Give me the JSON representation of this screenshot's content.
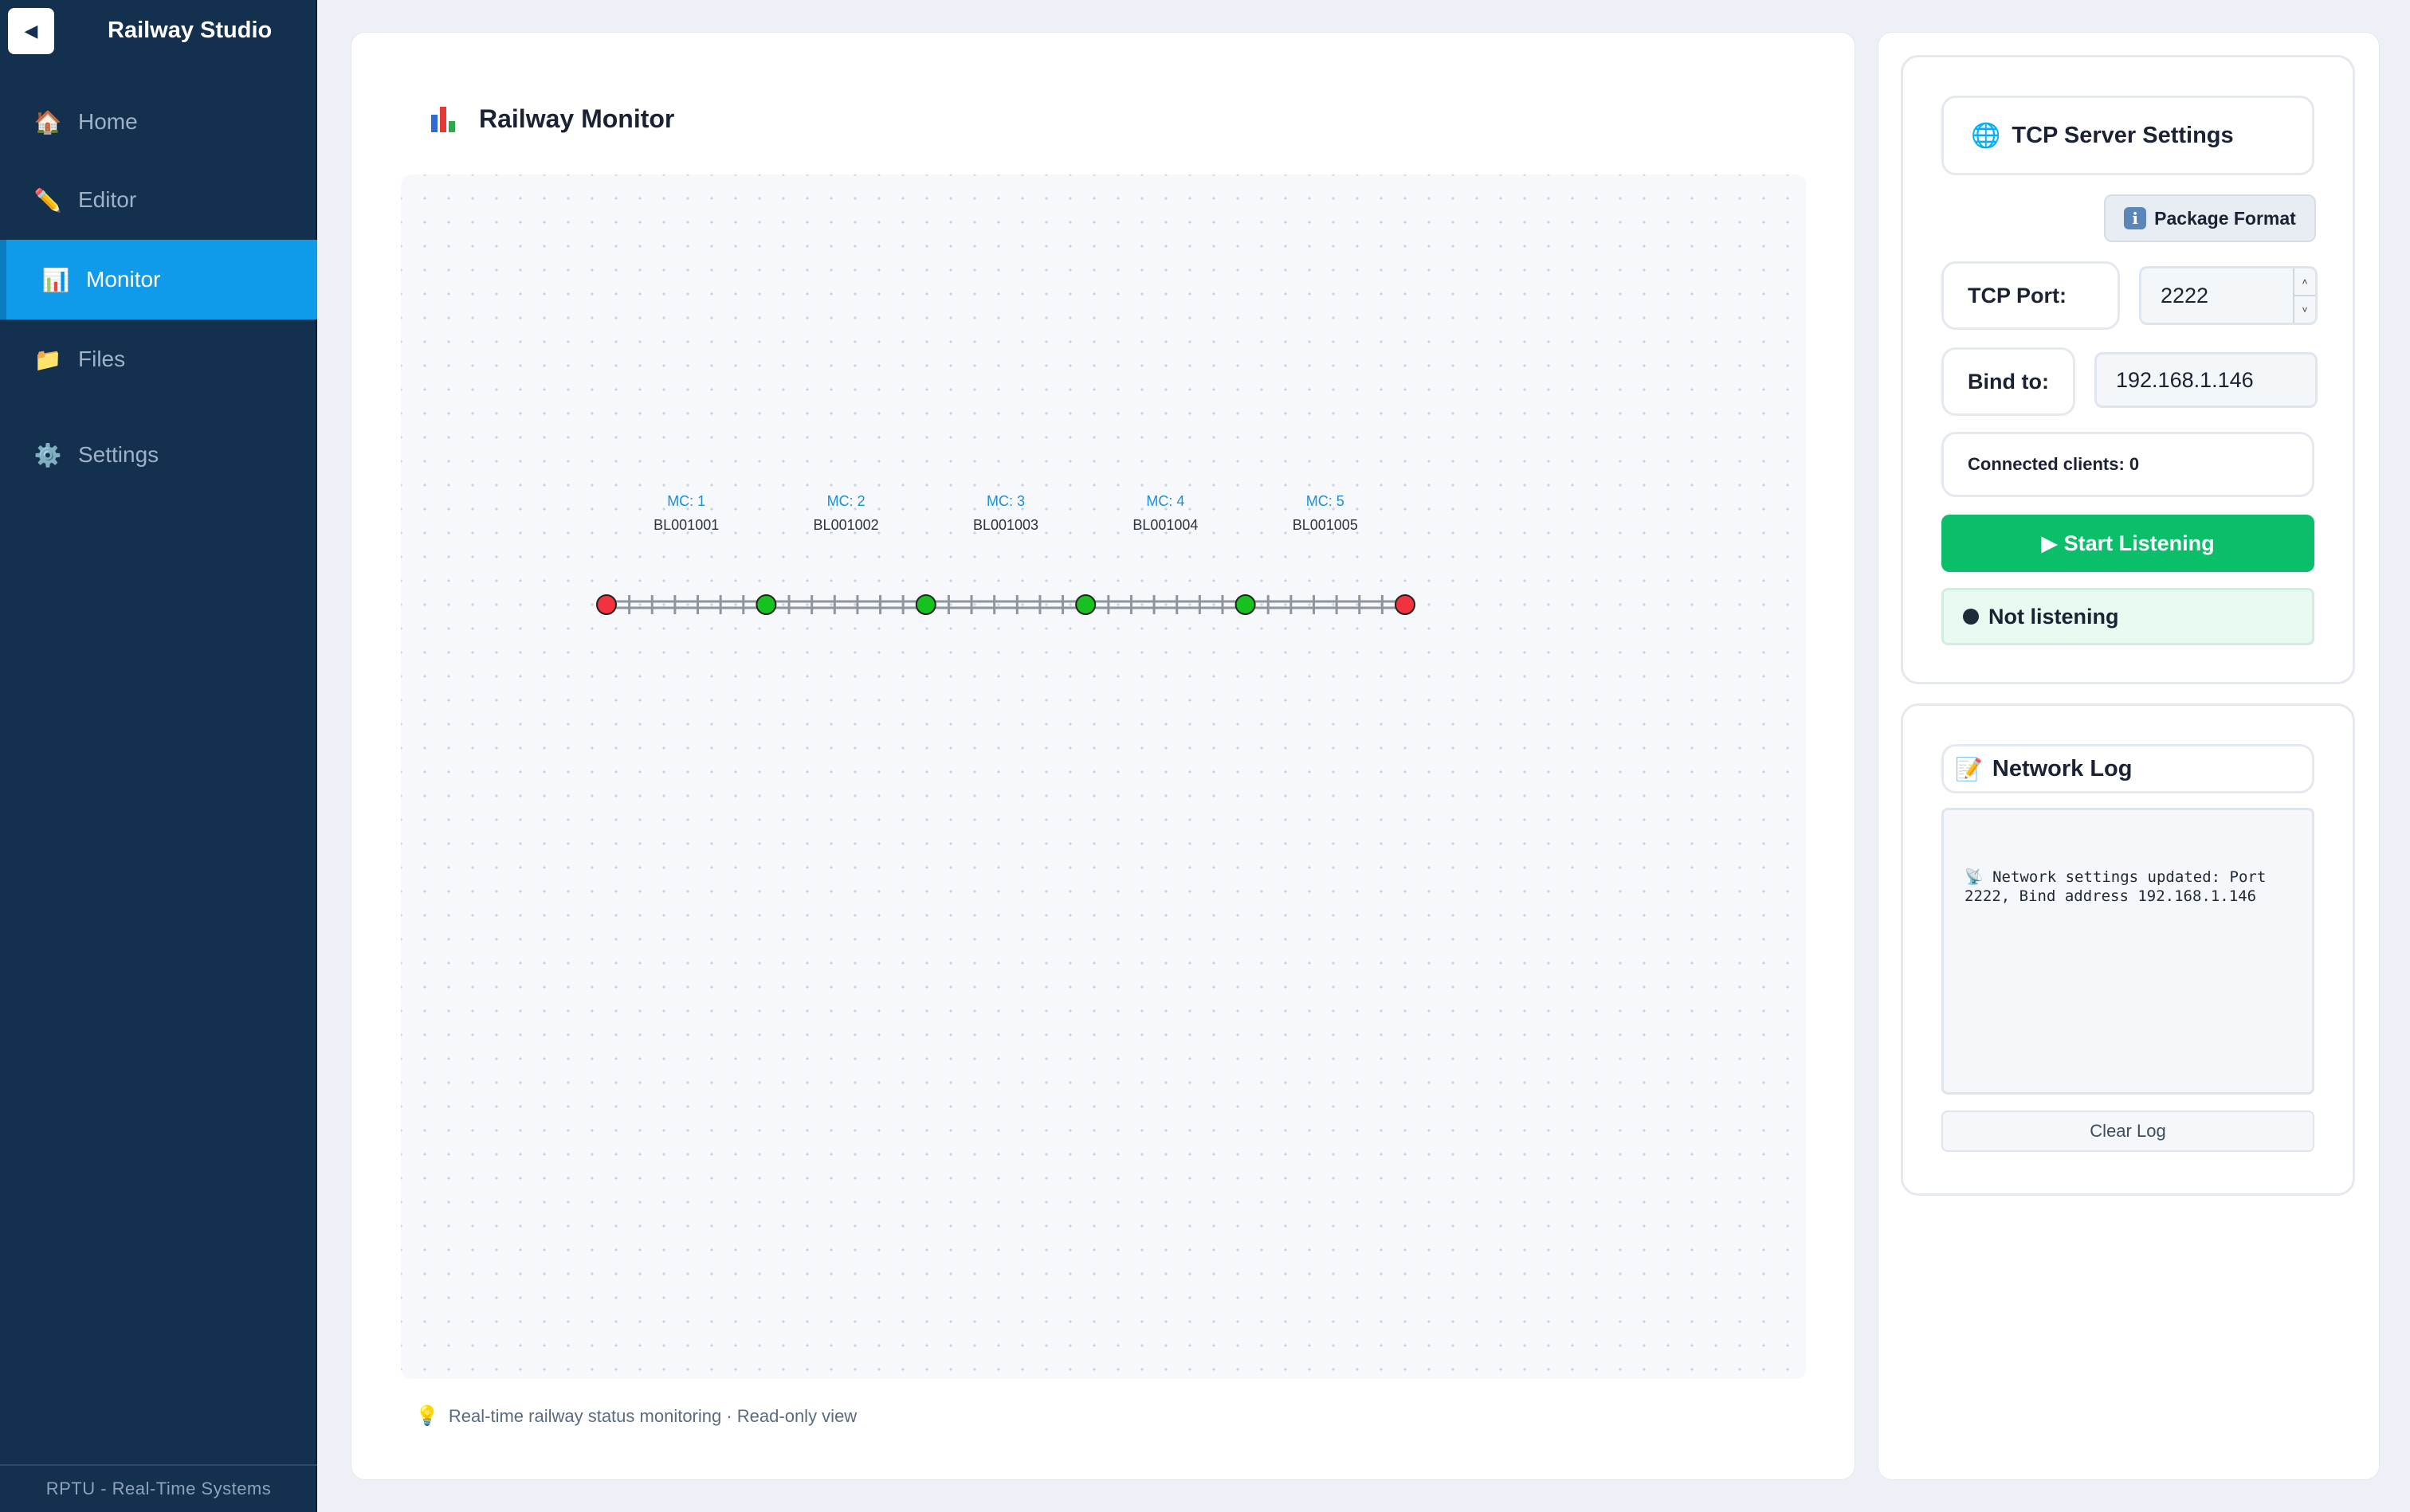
{
  "sidebar": {
    "collapse_icon": "◀",
    "app_title": "Railway Studio",
    "items": [
      {
        "label": "Home",
        "icon": "🏠"
      },
      {
        "label": "Editor",
        "icon": "✏️"
      },
      {
        "label": "Monitor",
        "icon": "📊"
      },
      {
        "label": "Files",
        "icon": "📁"
      },
      {
        "label": "Settings",
        "icon": "⚙️"
      }
    ],
    "active_item": "Monitor",
    "footer": "RPTU - Real-Time Systems"
  },
  "main": {
    "title": "Railway Monitor",
    "hint_icon": "💡",
    "hint": "Real-time railway status monitoring · Read-only view",
    "track": {
      "segments": [
        {
          "mc": "MC: 1",
          "id": "BL001001"
        },
        {
          "mc": "MC: 2",
          "id": "BL001002"
        },
        {
          "mc": "MC: 3",
          "id": "BL001003"
        },
        {
          "mc": "MC: 4",
          "id": "BL001004"
        },
        {
          "mc": "MC: 5",
          "id": "BL001005"
        }
      ],
      "node_states": [
        "red",
        "green",
        "green",
        "green",
        "green",
        "red"
      ],
      "colors": {
        "red": "#f2333f",
        "green": "#17c21f",
        "rail": "#8f959c",
        "mc_label": "#1a8fd8"
      }
    }
  },
  "tcp": {
    "title": "TCP Server Settings",
    "package_format_label": "Package Format",
    "port_label": "TCP Port:",
    "port_value": "2222",
    "bind_label": "Bind to:",
    "bind_value": "192.168.1.146",
    "clients_text": "Connected clients: 0",
    "start_button": "▶ Start Listening",
    "status": "Not listening"
  },
  "log": {
    "title": "Network Log",
    "title_icon": "📝",
    "entries": [
      "📡 Network settings updated: Port 2222, Bind address 192.168.1.146"
    ],
    "clear_button": "Clear Log"
  }
}
